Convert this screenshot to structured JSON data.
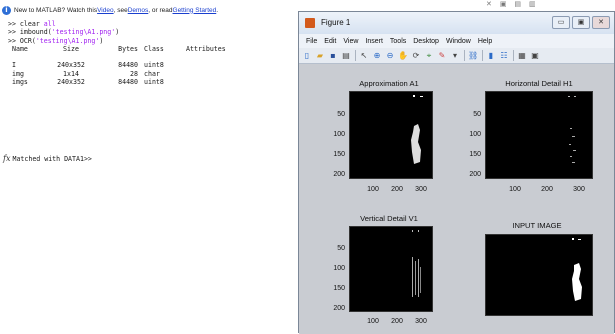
{
  "matlab": {
    "info": {
      "prefix": "New to MATLAB? Watch this ",
      "video_link": "Video",
      "mid1": ", see ",
      "demos_link": "Demos",
      "mid2": ", or read ",
      "started_link": "Getting Started",
      "suffix": "."
    },
    "commands": [
      {
        "prompt": ">> ",
        "cmd": "clear ",
        "arg": "all",
        "tail": ""
      },
      {
        "prompt": ">> ",
        "cmd": "imbound(",
        "arg": "'testing\\A1.png'",
        "tail": ")"
      },
      {
        "prompt": ">> ",
        "cmd": "OCR(",
        "arg": "'testing\\A1.png'",
        "tail": ")"
      }
    ],
    "whos_header": [
      "Name",
      "Size",
      "Bytes",
      "Class",
      "Attributes"
    ],
    "whos_rows": [
      [
        "I",
        "240x352",
        "84480",
        "uint8",
        ""
      ],
      [
        "img",
        "1x14",
        "28",
        "char",
        ""
      ],
      [
        "imgs",
        "240x352",
        "84480",
        "uint8",
        ""
      ]
    ],
    "fx_symbol": "fx",
    "last_line": "Matched with DATA1>>"
  },
  "figure": {
    "title": "Figure 1",
    "window_buttons": [
      "▭",
      "▣",
      "✕"
    ],
    "menu": [
      "File",
      "Edit",
      "View",
      "Insert",
      "Tools",
      "Desktop",
      "Window",
      "Help"
    ],
    "toolbar_icons": [
      "new-figure-icon",
      "open-icon",
      "save-icon",
      "print-icon",
      "pointer-icon",
      "zoom-in-icon",
      "zoom-out-icon",
      "pan-icon",
      "rotate-icon",
      "data-cursor-icon",
      "brush-icon",
      "link-icon",
      "colorbar-icon",
      "legend-icon",
      "hide-plot-tools-icon",
      "show-plot-tools-icon"
    ],
    "subplots": [
      {
        "title": "Approximation A1",
        "yticks": [
          "50",
          "100",
          "150",
          "200"
        ],
        "xticks": [
          "100",
          "200",
          "300"
        ]
      },
      {
        "title": "Horizontal Detail H1",
        "yticks": [
          "50",
          "100",
          "150",
          "200"
        ],
        "xticks": [
          "100",
          "200",
          "300"
        ]
      },
      {
        "title": "Vertical Detail V1",
        "yticks": [
          "50",
          "100",
          "150",
          "200"
        ],
        "xticks": [
          "100",
          "200",
          "300"
        ]
      },
      {
        "title": "INPUT IMAGE",
        "yticks": [],
        "xticks": []
      }
    ]
  }
}
